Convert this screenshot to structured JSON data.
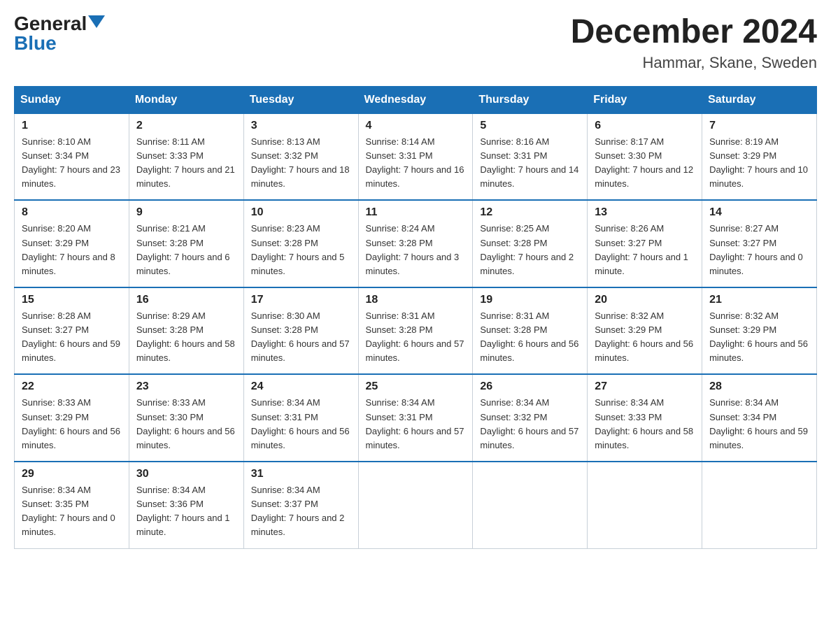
{
  "header": {
    "logo_general": "General",
    "logo_blue": "Blue",
    "month_title": "December 2024",
    "location": "Hammar, Skane, Sweden"
  },
  "days_of_week": [
    "Sunday",
    "Monday",
    "Tuesday",
    "Wednesday",
    "Thursday",
    "Friday",
    "Saturday"
  ],
  "weeks": [
    [
      {
        "date": "1",
        "sunrise": "8:10 AM",
        "sunset": "3:34 PM",
        "daylight": "7 hours and 23 minutes."
      },
      {
        "date": "2",
        "sunrise": "8:11 AM",
        "sunset": "3:33 PM",
        "daylight": "7 hours and 21 minutes."
      },
      {
        "date": "3",
        "sunrise": "8:13 AM",
        "sunset": "3:32 PM",
        "daylight": "7 hours and 18 minutes."
      },
      {
        "date": "4",
        "sunrise": "8:14 AM",
        "sunset": "3:31 PM",
        "daylight": "7 hours and 16 minutes."
      },
      {
        "date": "5",
        "sunrise": "8:16 AM",
        "sunset": "3:31 PM",
        "daylight": "7 hours and 14 minutes."
      },
      {
        "date": "6",
        "sunrise": "8:17 AM",
        "sunset": "3:30 PM",
        "daylight": "7 hours and 12 minutes."
      },
      {
        "date": "7",
        "sunrise": "8:19 AM",
        "sunset": "3:29 PM",
        "daylight": "7 hours and 10 minutes."
      }
    ],
    [
      {
        "date": "8",
        "sunrise": "8:20 AM",
        "sunset": "3:29 PM",
        "daylight": "7 hours and 8 minutes."
      },
      {
        "date": "9",
        "sunrise": "8:21 AM",
        "sunset": "3:28 PM",
        "daylight": "7 hours and 6 minutes."
      },
      {
        "date": "10",
        "sunrise": "8:23 AM",
        "sunset": "3:28 PM",
        "daylight": "7 hours and 5 minutes."
      },
      {
        "date": "11",
        "sunrise": "8:24 AM",
        "sunset": "3:28 PM",
        "daylight": "7 hours and 3 minutes."
      },
      {
        "date": "12",
        "sunrise": "8:25 AM",
        "sunset": "3:28 PM",
        "daylight": "7 hours and 2 minutes."
      },
      {
        "date": "13",
        "sunrise": "8:26 AM",
        "sunset": "3:27 PM",
        "daylight": "7 hours and 1 minute."
      },
      {
        "date": "14",
        "sunrise": "8:27 AM",
        "sunset": "3:27 PM",
        "daylight": "7 hours and 0 minutes."
      }
    ],
    [
      {
        "date": "15",
        "sunrise": "8:28 AM",
        "sunset": "3:27 PM",
        "daylight": "6 hours and 59 minutes."
      },
      {
        "date": "16",
        "sunrise": "8:29 AM",
        "sunset": "3:28 PM",
        "daylight": "6 hours and 58 minutes."
      },
      {
        "date": "17",
        "sunrise": "8:30 AM",
        "sunset": "3:28 PM",
        "daylight": "6 hours and 57 minutes."
      },
      {
        "date": "18",
        "sunrise": "8:31 AM",
        "sunset": "3:28 PM",
        "daylight": "6 hours and 57 minutes."
      },
      {
        "date": "19",
        "sunrise": "8:31 AM",
        "sunset": "3:28 PM",
        "daylight": "6 hours and 56 minutes."
      },
      {
        "date": "20",
        "sunrise": "8:32 AM",
        "sunset": "3:29 PM",
        "daylight": "6 hours and 56 minutes."
      },
      {
        "date": "21",
        "sunrise": "8:32 AM",
        "sunset": "3:29 PM",
        "daylight": "6 hours and 56 minutes."
      }
    ],
    [
      {
        "date": "22",
        "sunrise": "8:33 AM",
        "sunset": "3:29 PM",
        "daylight": "6 hours and 56 minutes."
      },
      {
        "date": "23",
        "sunrise": "8:33 AM",
        "sunset": "3:30 PM",
        "daylight": "6 hours and 56 minutes."
      },
      {
        "date": "24",
        "sunrise": "8:34 AM",
        "sunset": "3:31 PM",
        "daylight": "6 hours and 56 minutes."
      },
      {
        "date": "25",
        "sunrise": "8:34 AM",
        "sunset": "3:31 PM",
        "daylight": "6 hours and 57 minutes."
      },
      {
        "date": "26",
        "sunrise": "8:34 AM",
        "sunset": "3:32 PM",
        "daylight": "6 hours and 57 minutes."
      },
      {
        "date": "27",
        "sunrise": "8:34 AM",
        "sunset": "3:33 PM",
        "daylight": "6 hours and 58 minutes."
      },
      {
        "date": "28",
        "sunrise": "8:34 AM",
        "sunset": "3:34 PM",
        "daylight": "6 hours and 59 minutes."
      }
    ],
    [
      {
        "date": "29",
        "sunrise": "8:34 AM",
        "sunset": "3:35 PM",
        "daylight": "7 hours and 0 minutes."
      },
      {
        "date": "30",
        "sunrise": "8:34 AM",
        "sunset": "3:36 PM",
        "daylight": "7 hours and 1 minute."
      },
      {
        "date": "31",
        "sunrise": "8:34 AM",
        "sunset": "3:37 PM",
        "daylight": "7 hours and 2 minutes."
      },
      null,
      null,
      null,
      null
    ]
  ]
}
